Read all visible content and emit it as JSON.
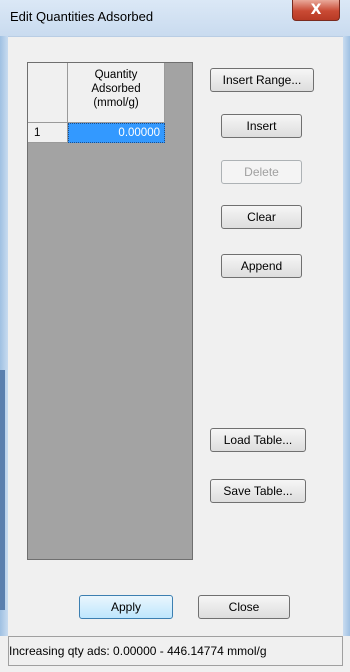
{
  "window": {
    "title": "Edit Quantities Adsorbed",
    "close_glyph": "X"
  },
  "grid": {
    "column_header": [
      "Quantity",
      "Adsorbed",
      "(mmol/g)"
    ],
    "rows": [
      {
        "index": "1",
        "value": "0.00000"
      }
    ]
  },
  "buttons": {
    "insert_range": "Insert Range...",
    "insert": "Insert",
    "delete": "Delete",
    "clear": "Clear",
    "append": "Append",
    "load_table": "Load Table...",
    "save_table": "Save Table...",
    "apply": "Apply",
    "close": "Close"
  },
  "status": {
    "text": "Increasing qty ads: 0.00000 - 446.14774 mmol/g"
  },
  "colors": {
    "selection": "#3399ff",
    "grid_background": "#a3a3a3"
  }
}
